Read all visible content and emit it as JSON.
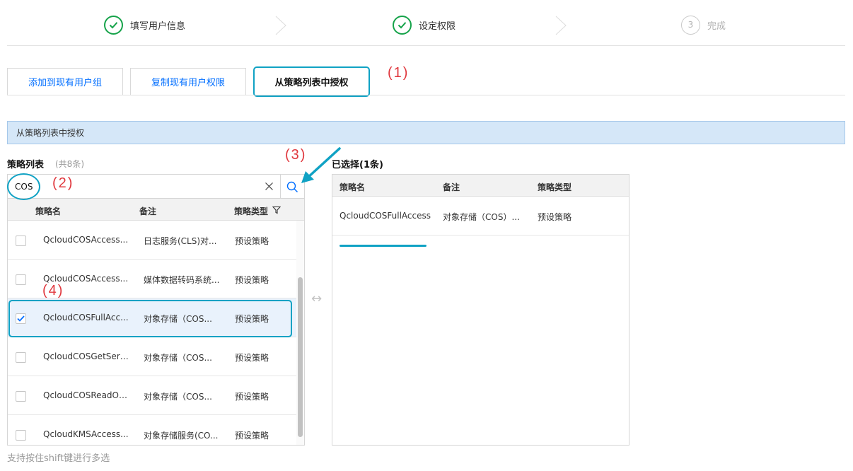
{
  "steps": [
    {
      "label": "填写用户信息",
      "status": "done"
    },
    {
      "label": "设定权限",
      "status": "done"
    },
    {
      "number": "3",
      "label": "完成",
      "status": "pending"
    }
  ],
  "tabs": [
    {
      "label": "添加到现有用户组",
      "active": false
    },
    {
      "label": "复制现有用户权限",
      "active": false
    },
    {
      "label": "从策略列表中授权",
      "active": true
    }
  ],
  "annotations": {
    "a1": "(1)",
    "a2": "(2)",
    "a3": "(3)",
    "a4": "(4)"
  },
  "banner": "从策略列表中授权",
  "policy_list": {
    "title": "策略列表",
    "count_label": "(共8条)",
    "search_value": "COS",
    "columns": [
      "策略名",
      "备注",
      "策略类型"
    ],
    "rows": [
      {
        "name": "QcloudCOSAccess...",
        "remark": "日志服务(CLS)对...",
        "type": "预设策略",
        "checked": false
      },
      {
        "name": "QcloudCOSAccess...",
        "remark": "媒体数据转码系统...",
        "type": "预设策略",
        "checked": false
      },
      {
        "name": "QcloudCOSFullAcc...",
        "remark": "对象存储（COS...",
        "type": "预设策略",
        "checked": true
      },
      {
        "name": "QcloudCOSGetServ...",
        "remark": "对象存储（COS...",
        "type": "预设策略",
        "checked": false
      },
      {
        "name": "QcloudCOSReadOn...",
        "remark": "对象存储（COS...",
        "type": "预设策略",
        "checked": false
      },
      {
        "name": "QcloudKMSAccess...",
        "remark": "对象存储服务(CO...",
        "type": "预设策略",
        "checked": false
      }
    ]
  },
  "hint": "支持按住shift键进行多选",
  "selected_list": {
    "title": "已选择(1条)",
    "columns": [
      "策略名",
      "备注",
      "策略类型"
    ],
    "rows": [
      {
        "name": "QcloudCOSFullAccess",
        "remark": "对象存储（COS）...",
        "type": "预设策略"
      }
    ]
  },
  "colors": {
    "accent": "#10a2c4",
    "link": "#006eff",
    "success": "#16a34a",
    "annotation": "#e0383e",
    "banner_bg": "#d5e7f8"
  }
}
